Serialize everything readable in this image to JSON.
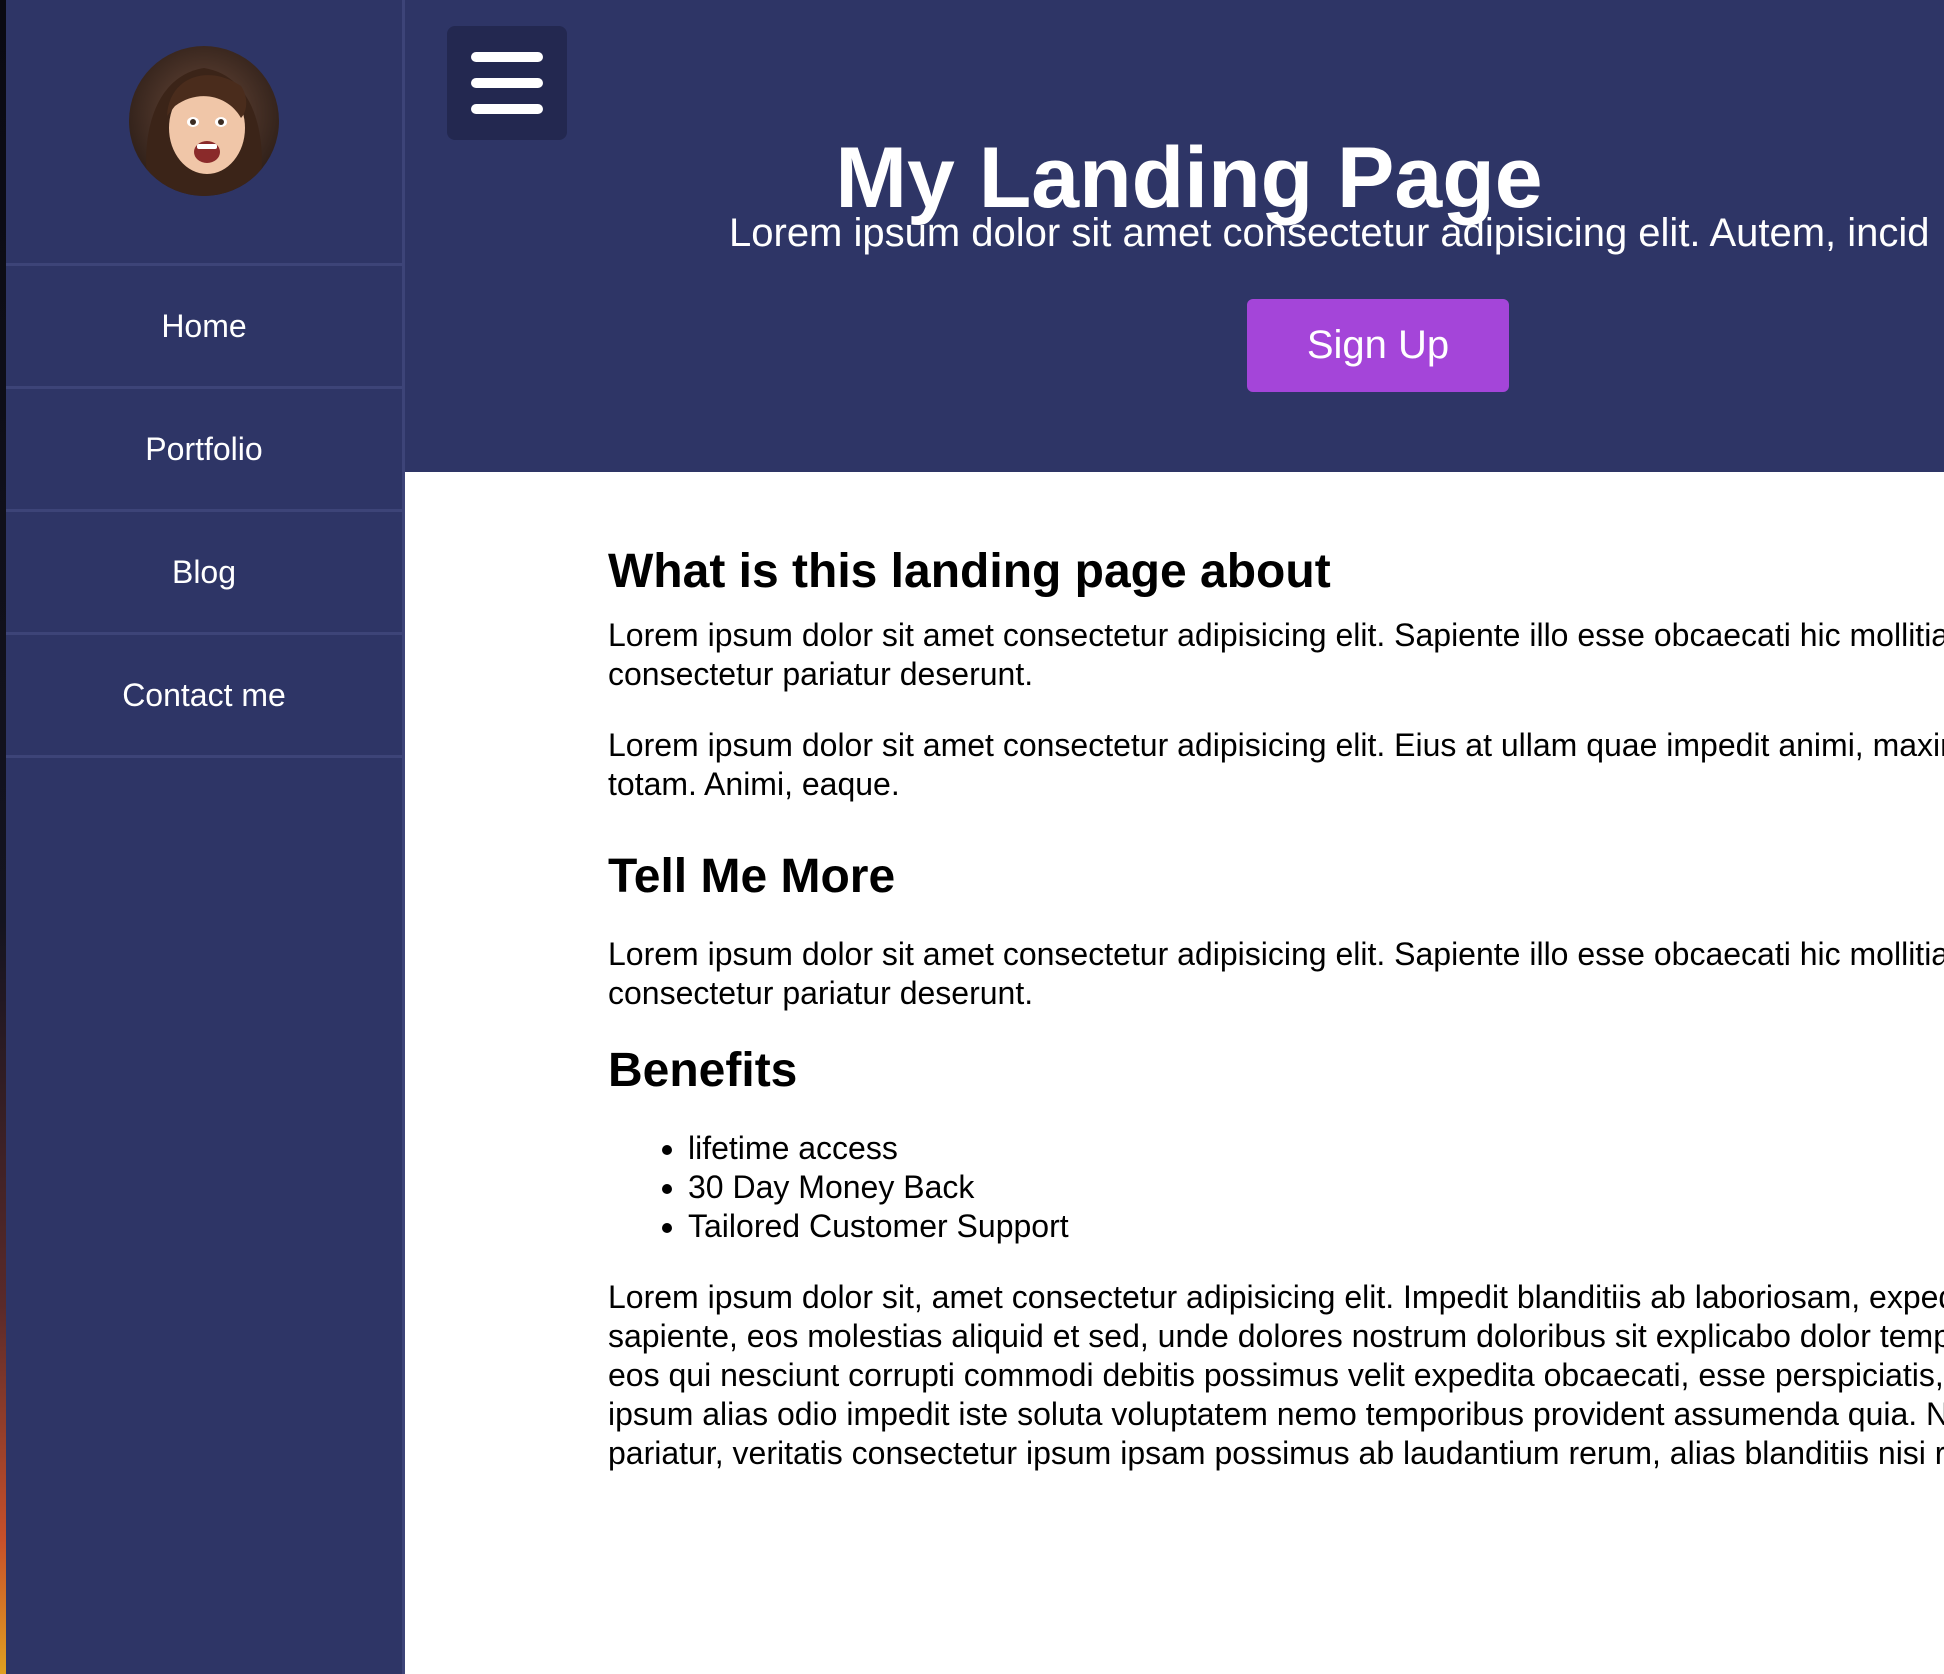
{
  "sidebar": {
    "avatar_alt": "profile photo",
    "items": [
      {
        "label": "Home"
      },
      {
        "label": "Portfolio"
      },
      {
        "label": "Blog"
      },
      {
        "label": "Contact me"
      }
    ]
  },
  "hero": {
    "menu_icon": "hamburger-icon",
    "title": "My Landing Page",
    "subtitle": "Lorem ipsum dolor sit amet consectetur adipisicing elit. Autem, incid",
    "signup_label": "Sign Up"
  },
  "content": {
    "section1": {
      "heading": "What is this landing page about",
      "p1_line1": "Lorem ipsum dolor sit amet consectetur adipisicing elit. Sapiente illo esse obcaecati hic mollitia ve",
      "p1_line2": "consectetur pariatur deserunt.",
      "p2_line1": "Lorem ipsum dolor sit amet consectetur adipisicing elit. Eius at ullam quae impedit animi, maxime",
      "p2_line2": "totam. Animi, eaque."
    },
    "section2": {
      "heading": "Tell Me More",
      "p1_line1": "Lorem ipsum dolor sit amet consectetur adipisicing elit. Sapiente illo esse obcaecati hic mollitia ve",
      "p1_line2": "consectetur pariatur deserunt."
    },
    "section3": {
      "heading": "Benefits",
      "benefits": [
        "lifetime access",
        "30 Day Money Back",
        "Tailored Customer Support"
      ],
      "p_lines": [
        "Lorem ipsum dolor sit, amet consectetur adipisicing elit. Impedit blanditiis ab laboriosam, expedit",
        "sapiente, eos molestias aliquid et sed, unde dolores nostrum doloribus sit explicabo dolor tempor",
        "eos qui nesciunt corrupti commodi debitis possimus velit expedita obcaecati, esse perspiciatis, do",
        "ipsum alias odio impedit iste soluta voluptatem nemo temporibus provident assumenda quia. Nec",
        "pariatur, veritatis consectetur ipsum ipsam possimus ab laudantium rerum, alias blanditiis nisi rei"
      ]
    }
  },
  "colors": {
    "navy": "#2e3566",
    "hamburger_bg": "#232850",
    "accent": "#a445d9",
    "divider": "#3d4478"
  }
}
